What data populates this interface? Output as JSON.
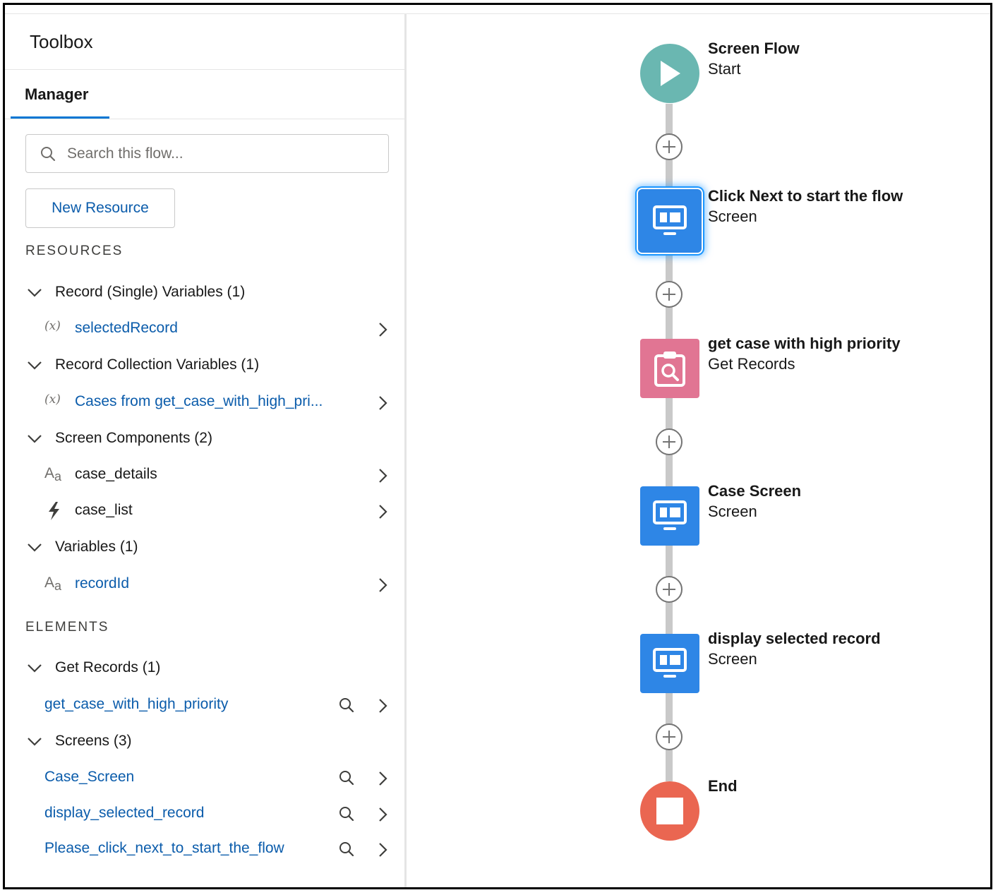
{
  "toolbox": {
    "title": "Toolbox",
    "tab_label": "Manager",
    "search_placeholder": "Search this flow...",
    "new_resource_label": "New Resource",
    "resources_heading": "RESOURCES",
    "resource_groups": [
      {
        "label": "Record (Single) Variables (1)",
        "items": [
          {
            "label": "selectedRecord",
            "icon": "variable-icon"
          }
        ]
      },
      {
        "label": "Record Collection Variables (1)",
        "items": [
          {
            "label": "Cases from get_case_with_high_pri...",
            "icon": "variable-icon"
          }
        ]
      },
      {
        "label": "Screen Components (2)",
        "items": [
          {
            "label": "case_details",
            "icon": "text-type-icon"
          },
          {
            "label": "case_list",
            "icon": "lightning-icon"
          }
        ]
      },
      {
        "label": "Variables (1)",
        "items": [
          {
            "label": "recordId",
            "icon": "text-type-icon"
          }
        ]
      }
    ],
    "elements_heading": "ELEMENTS",
    "element_groups": [
      {
        "label": "Get Records (1)",
        "items": [
          "get_case_with_high_priority"
        ]
      },
      {
        "label": "Screens (3)",
        "items": [
          "Case_Screen",
          "display_selected_record",
          "Please_click_next_to_start_the_flow"
        ]
      }
    ],
    "variable_glyph": "(x)",
    "text_type_glyph": "A",
    "text_type_sub": "a"
  },
  "canvas": {
    "nodes": [
      {
        "title": "Screen Flow",
        "subtitle": "Start",
        "kind": "start",
        "icon": "play-icon",
        "color": "#6ab7b1"
      },
      {
        "title": "Click Next to start the flow",
        "subtitle": "Screen",
        "kind": "screen",
        "icon": "screen-icon",
        "color": "#2e86e6",
        "selected": true
      },
      {
        "title": "get case with high priority",
        "subtitle": "Get Records",
        "kind": "get-records",
        "icon": "clipboard-search-icon",
        "color": "#e17593"
      },
      {
        "title": "Case Screen",
        "subtitle": "Screen",
        "kind": "screen",
        "icon": "screen-icon",
        "color": "#2e86e6"
      },
      {
        "title": "display selected record",
        "subtitle": "Screen",
        "kind": "screen",
        "icon": "screen-icon",
        "color": "#2e86e6"
      },
      {
        "title": "End",
        "subtitle": "",
        "kind": "end",
        "icon": "stop-icon",
        "color": "#ea6651"
      }
    ]
  },
  "colors": {
    "link": "#0b5cab",
    "accent": "#0176d3",
    "connector": "#c9c9c9"
  }
}
